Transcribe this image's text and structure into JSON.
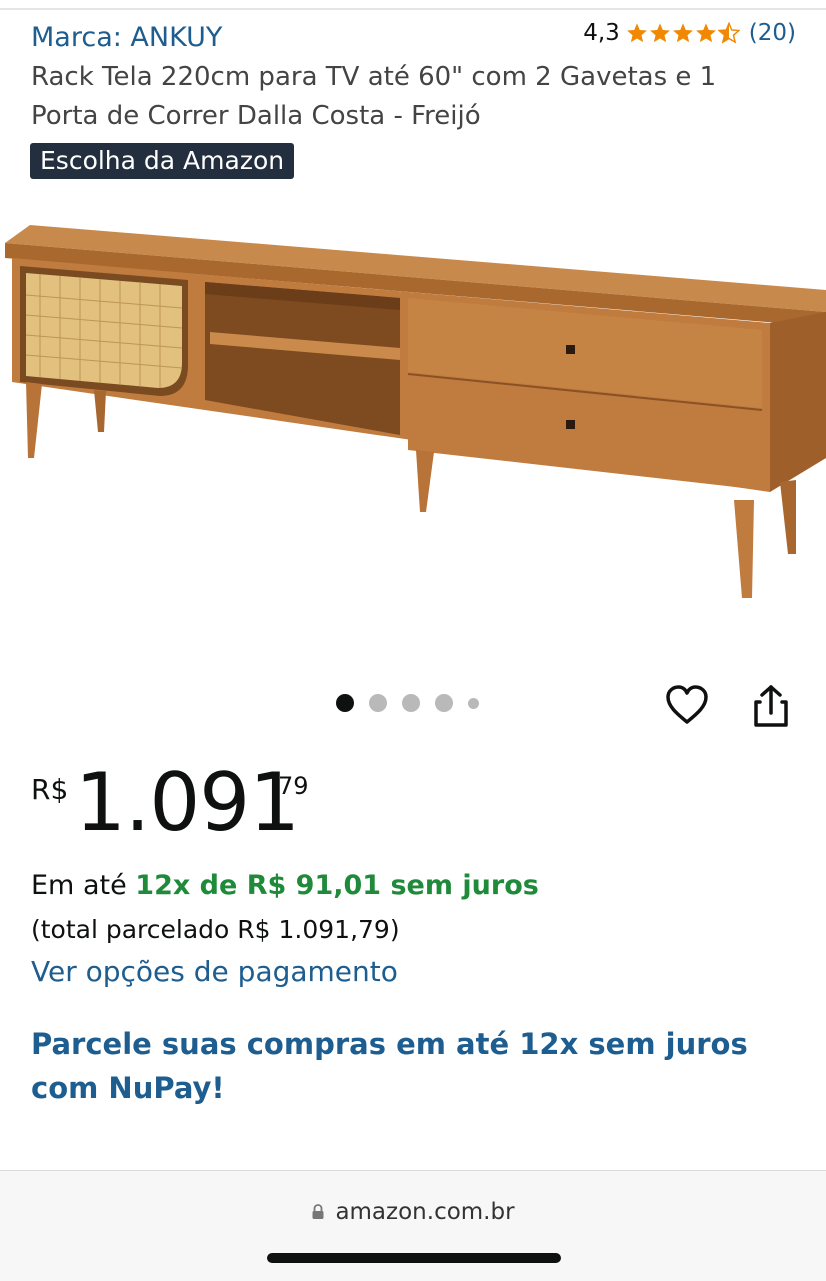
{
  "header": {
    "brand": "Marca: ANKUY",
    "rating_value": "4,3",
    "rating_stars": 4.3,
    "review_count": "(20)",
    "star_color": "#f08804"
  },
  "product": {
    "title": "Rack Tela 220cm para TV até 60\" com 2 Gavetas e 1 Porta de Correr Dalla Costa - Freijó",
    "badge": "Escolha da Amazon"
  },
  "gallery": {
    "image_count": 5,
    "active_index": 0,
    "icons": [
      "heart-icon",
      "share-icon"
    ]
  },
  "price": {
    "currency": "R$",
    "whole": "1.091",
    "cents": "79"
  },
  "installments": {
    "prefix": "Em até",
    "offer": "12x de R$ 91,01 sem juros",
    "total": "(total parcelado R$ 1.091,79)",
    "link": "Ver opções de pagamento"
  },
  "promo": {
    "nupay": "Parcele suas compras em até 12x sem juros com NuPay!"
  },
  "browser": {
    "url": "amazon.com.br"
  },
  "colors": {
    "link_blue": "#1d5d8f",
    "offer_green": "#1f8a3a",
    "badge_bg": "#232f3e"
  }
}
